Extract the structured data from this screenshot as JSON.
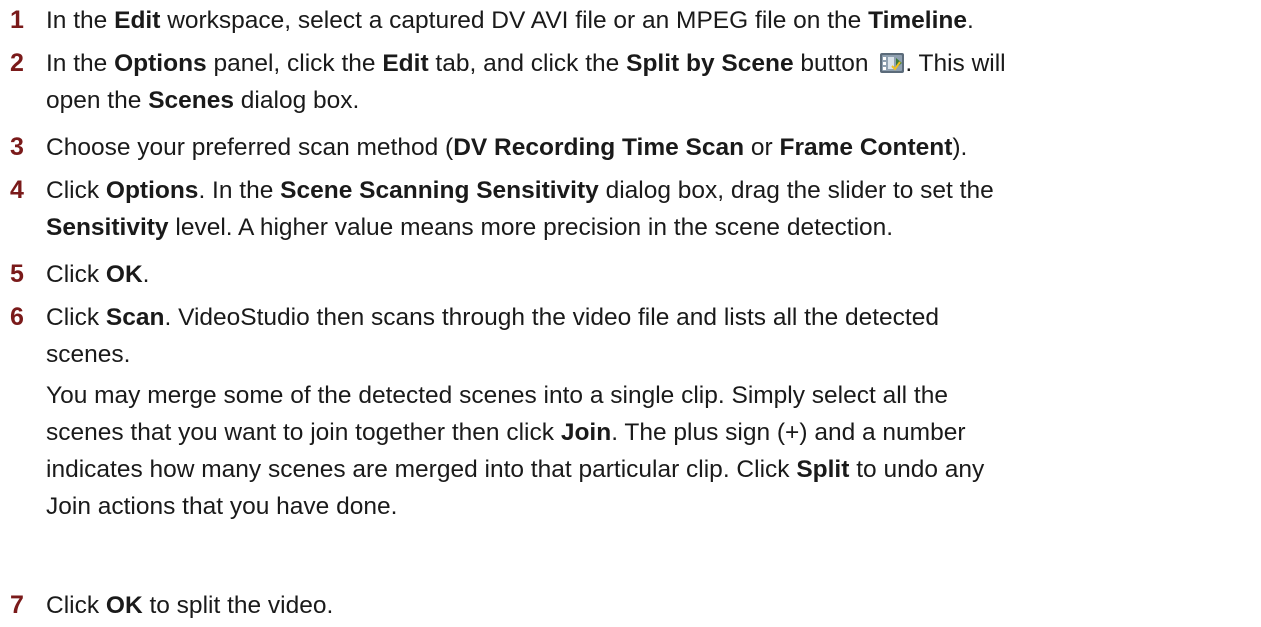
{
  "steps": [
    {
      "num": "1",
      "lines": [
        [
          {
            "t": "In the "
          },
          {
            "t": "Edit",
            "b": true
          },
          {
            "t": " workspace, select a captured DV AVI file or an MPEG file on the "
          },
          {
            "t": "Timeline",
            "b": true
          },
          {
            "t": "."
          }
        ]
      ]
    },
    {
      "num": "2",
      "lines": [
        [
          {
            "t": "In the "
          },
          {
            "t": "Options",
            "b": true
          },
          {
            "t": " panel, click the "
          },
          {
            "t": "Edit",
            "b": true
          },
          {
            "t": " tab, and click the "
          },
          {
            "t": "Split by Scene",
            "b": true
          },
          {
            "t": " button "
          },
          {
            "icon": "split-by-scene-icon"
          },
          {
            "t": ". This will"
          }
        ],
        [
          {
            "t": "open the "
          },
          {
            "t": "Scenes",
            "b": true
          },
          {
            "t": " dialog box."
          }
        ]
      ]
    },
    {
      "num": "3",
      "lines": [
        [
          {
            "t": "Choose your preferred scan method ("
          },
          {
            "t": "DV Recording Time Scan",
            "b": true
          },
          {
            "t": " or "
          },
          {
            "t": "Frame Content",
            "b": true
          },
          {
            "t": ")."
          }
        ]
      ]
    },
    {
      "num": "4",
      "lines": [
        [
          {
            "t": "Click "
          },
          {
            "t": "Options",
            "b": true
          },
          {
            "t": ". In the "
          },
          {
            "t": "Scene Scanning Sensitivity",
            "b": true
          },
          {
            "t": " dialog box, drag the slider to set the"
          }
        ],
        [
          {
            "t": "Sensitivity",
            "b": true
          },
          {
            "t": " level. A higher value means more precision in the scene detection."
          }
        ]
      ]
    },
    {
      "num": "5",
      "lines": [
        [
          {
            "t": "Click "
          },
          {
            "t": "OK",
            "b": true
          },
          {
            "t": "."
          }
        ]
      ]
    },
    {
      "num": "6",
      "lines": [
        [
          {
            "t": "Click "
          },
          {
            "t": "Scan",
            "b": true
          },
          {
            "t": ". VideoStudio then scans through the video file and lists all the detected"
          }
        ],
        [
          {
            "t": "scenes."
          }
        ]
      ],
      "para": [
        [
          {
            "t": "You may merge some of the detected scenes into a single clip. Simply select all the"
          }
        ],
        [
          {
            "t": "scenes that you want to join together then click "
          },
          {
            "t": "Join",
            "b": true
          },
          {
            "t": ". The plus sign (+) and a number"
          }
        ],
        [
          {
            "t": "indicates how many scenes are merged into that particular clip. Click "
          },
          {
            "t": "Split",
            "b": true
          },
          {
            "t": " to undo any"
          }
        ],
        [
          {
            "t": "Join actions that you have done."
          }
        ]
      ]
    },
    {
      "num": "7",
      "lines": [
        [
          {
            "t": "Click "
          },
          {
            "t": "OK",
            "b": true
          },
          {
            "t": " to split the video."
          }
        ]
      ]
    }
  ],
  "colors": {
    "step_number": "#7a1a1a",
    "text": "#1a1a1a"
  }
}
